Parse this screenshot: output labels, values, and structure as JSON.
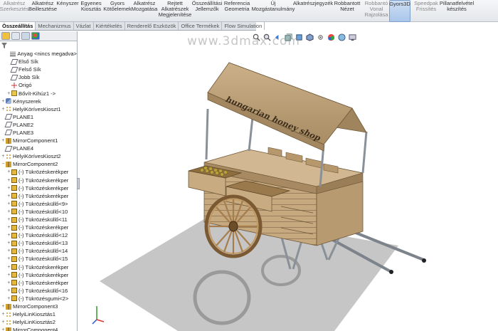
{
  "ribbon": {
    "buttons": [
      {
        "label": "Alkatrész\nSzerkesztés",
        "disabled": true
      },
      {
        "label": "Alkatrész\nBeillesztése",
        "disabled": false
      },
      {
        "label": "Kényszer",
        "disabled": false
      },
      {
        "label": "Egyenes\nKiosztás",
        "disabled": false
      },
      {
        "label": "Gyors\nKötőelemek",
        "disabled": false
      },
      {
        "label": "Alkatrész\nMozgatása",
        "disabled": false
      },
      {
        "label": "Rejtett\nAlkatrészek\nMegjelenítése",
        "disabled": false
      },
      {
        "label": "Összeállítási\nJellemzők",
        "disabled": false
      },
      {
        "label": "Referencia\nGeometria",
        "disabled": false
      },
      {
        "label": "Új\nMozgástanulmány",
        "disabled": false
      },
      {
        "label": "Alkatrészjegyzék",
        "disabled": false
      },
      {
        "label": "Robbantott\nNézet",
        "disabled": false
      },
      {
        "label": "Robbantó\nVonal\nRajzolása",
        "disabled": true
      },
      {
        "label": "Gyors3D",
        "disabled": false
      },
      {
        "label": "Speedpak\nFrissítés",
        "disabled": true
      },
      {
        "label": "Pillanatfelvétel\nkészítés",
        "disabled": false
      }
    ]
  },
  "tabs": [
    "Összeállítás",
    "Mechanizmus",
    "Vázlat",
    "Kiértékelés",
    "Renderelő Eszközök",
    "Office Termékek",
    "Flow Simulation"
  ],
  "active_tab": "Összeállítás",
  "watermark": "www.3dmax.com",
  "tree": [
    {
      "label": "Anyag <nincs megadva>",
      "icon": "material-icon",
      "indent": 1
    },
    {
      "label": "Első Sík",
      "icon": "plane-icon",
      "indent": 1
    },
    {
      "label": "Felső Sík",
      "icon": "plane-icon",
      "indent": 1
    },
    {
      "label": "Jobb Sík",
      "icon": "plane-icon",
      "indent": 1
    },
    {
      "label": "Origó",
      "icon": "origin-icon",
      "indent": 1
    },
    {
      "label": "Bővít-Kihúz1 ->",
      "icon": "feature-icon",
      "indent": 1,
      "expander": "+"
    },
    {
      "label": "Kényszerek",
      "icon": "mates-icon",
      "indent": 0,
      "expander": "+"
    },
    {
      "label": "HelyiKörívesKioszt1",
      "icon": "pattern-icon",
      "indent": 0,
      "expander": "+"
    },
    {
      "label": "PLANE1",
      "icon": "plane-icon",
      "indent": 0
    },
    {
      "label": "PLANE2",
      "icon": "plane-icon",
      "indent": 0
    },
    {
      "label": "PLANE3",
      "icon": "plane-icon",
      "indent": 0
    },
    {
      "label": "MirrorComponent1",
      "icon": "mirror-icon",
      "indent": 0,
      "expander": "+"
    },
    {
      "label": "PLANE4",
      "icon": "plane-icon",
      "indent": 0
    },
    {
      "label": "HelyiKörívesKioszt2",
      "icon": "pattern-icon",
      "indent": 0,
      "expander": "+"
    },
    {
      "label": "MirrorComponent2",
      "icon": "mirror-icon",
      "indent": 0,
      "expander": "-"
    },
    {
      "label": "(-) Tükrözéskerékper",
      "icon": "part-icon",
      "indent": 1,
      "expander": "+"
    },
    {
      "label": "(-) Tükrözéskerékper",
      "icon": "part-icon",
      "indent": 1,
      "expander": "+"
    },
    {
      "label": "(-) Tükrözéskerékper",
      "icon": "part-icon",
      "indent": 1,
      "expander": "+"
    },
    {
      "label": "(-) Tükrözéskerékper",
      "icon": "part-icon",
      "indent": 1,
      "expander": "+"
    },
    {
      "label": "(-) Tükrözésküllő<9>",
      "icon": "part-icon",
      "indent": 1,
      "expander": "+"
    },
    {
      "label": "(-) Tükrözésküllő<10",
      "icon": "part-icon",
      "indent": 1,
      "expander": "+"
    },
    {
      "label": "(-) Tükrözésküllő<11",
      "icon": "part-icon",
      "indent": 1,
      "expander": "+"
    },
    {
      "label": "(-) Tükrözéskerékper",
      "icon": "part-icon",
      "indent": 1,
      "expander": "+"
    },
    {
      "label": "(-) Tükrözésküllő<12",
      "icon": "part-icon",
      "indent": 1,
      "expander": "+"
    },
    {
      "label": "(-) Tükrözésküllő<13",
      "icon": "part-icon",
      "indent": 1,
      "expander": "+"
    },
    {
      "label": "(-) Tükrözésküllő<14",
      "icon": "part-icon",
      "indent": 1,
      "expander": "+"
    },
    {
      "label": "(-) Tükrözésküllő<15",
      "icon": "part-icon",
      "indent": 1,
      "expander": "+"
    },
    {
      "label": "(-) Tükrözéskerékper",
      "icon": "part-icon",
      "indent": 1,
      "expander": "+"
    },
    {
      "label": "(-) Tükrözéskerékper",
      "icon": "part-icon",
      "indent": 1,
      "expander": "+"
    },
    {
      "label": "(-) Tükrözéskerékper",
      "icon": "part-icon",
      "indent": 1,
      "expander": "+"
    },
    {
      "label": "(-) Tükrözésküllő<16",
      "icon": "part-icon",
      "indent": 1,
      "expander": "+"
    },
    {
      "label": "(-) Tükrözésgumi<2>",
      "icon": "part-icon",
      "indent": 1,
      "expander": "+"
    },
    {
      "label": "MirrorComponent3",
      "icon": "mirror-icon",
      "indent": 0,
      "expander": "+"
    },
    {
      "label": "HelyiLinKiosztás1",
      "icon": "pattern-icon",
      "indent": 0,
      "expander": "+"
    },
    {
      "label": "HelyiLinKiosztás2",
      "icon": "pattern-icon",
      "indent": 0,
      "expander": "+"
    },
    {
      "label": "MirrorComponent4",
      "icon": "mirror-icon",
      "indent": 0,
      "expander": "+"
    }
  ],
  "model": {
    "sign_text": "hungarian honey shop"
  },
  "colors": {
    "wood": "#bfa27a",
    "wood_dark": "#8f7453",
    "canopy": "#b49970",
    "metal": "#9aa0a8",
    "selection": "#a9c6ea"
  }
}
